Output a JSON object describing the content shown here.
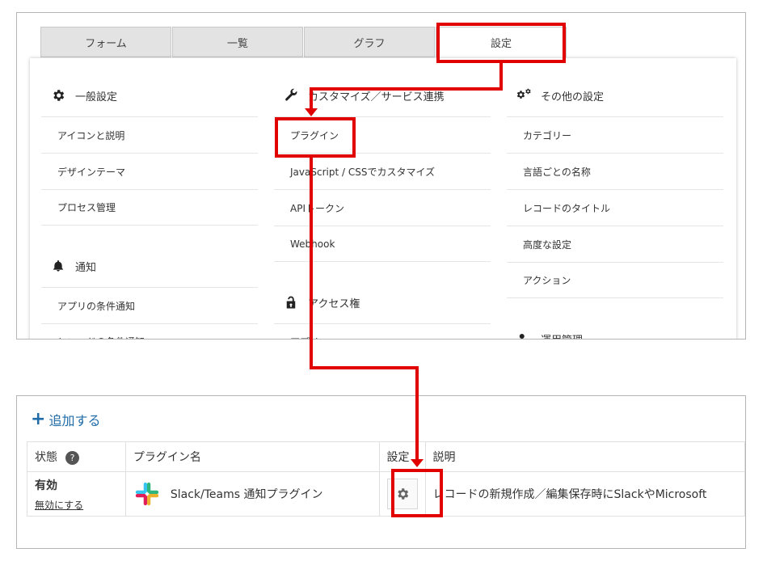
{
  "tabs": [
    {
      "label": "フォーム"
    },
    {
      "label": "一覧"
    },
    {
      "label": "グラフ"
    },
    {
      "label": "設定"
    }
  ],
  "general": {
    "heading": "一般設定",
    "items": [
      "アイコンと説明",
      "デザインテーマ",
      "プロセス管理"
    ]
  },
  "notify": {
    "heading": "通知",
    "items": [
      "アプリの条件通知",
      "レコードの条件通知"
    ]
  },
  "customize": {
    "heading": "カスタマイズ／サービス連携",
    "items": [
      "プラグイン",
      "JavaScript / CSSでカスタマイズ",
      "APIトークン",
      "Webhook"
    ]
  },
  "access": {
    "heading": "アクセス権",
    "items": [
      "アプリ"
    ]
  },
  "other": {
    "heading": "その他の設定",
    "items": [
      "カテゴリー",
      "言語ごとの名称",
      "レコードのタイトル",
      "高度な設定",
      "アクション"
    ]
  },
  "ops": {
    "heading": "運用管理"
  },
  "plugins_panel": {
    "add_label": "追加する",
    "headers": {
      "status": "状態",
      "name": "プラグイン名",
      "settings": "設定",
      "description": "説明"
    },
    "rows": [
      {
        "status": "有効",
        "toggle": "無効にする",
        "name": "Slack/Teams 通知プラグイン",
        "description": "レコードの新規作成／編集保存時にSlackやMicrosoft"
      }
    ]
  },
  "colors": {
    "accent": "#1f6ba8",
    "highlight": "#e00000"
  },
  "icons": [
    "gear-icon",
    "bell-icon",
    "wrench-icon",
    "lock-icon",
    "gears-icon",
    "slack-icon",
    "plus-icon",
    "help-icon"
  ]
}
